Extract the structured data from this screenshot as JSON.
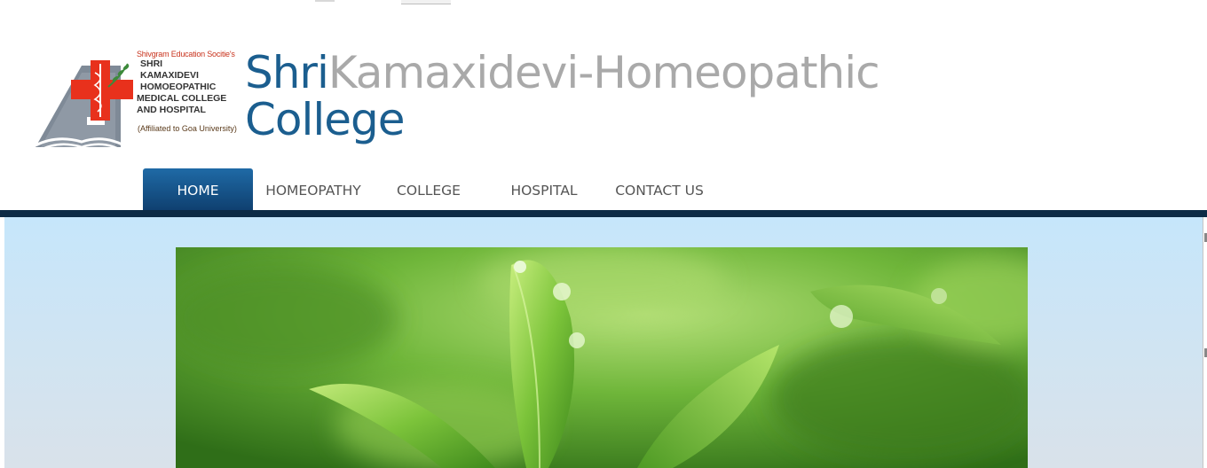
{
  "logo": {
    "society": "Shivgram Education Socitie's",
    "lines": [
      "SHRI",
      "KAMAXIDEVI",
      "HOMOEOPATHIC",
      "MEDICAL COLLEGE",
      "AND HOSPITAL"
    ],
    "affiliation": "(Affiliated to Goa University)",
    "cross_color": "#e8311c",
    "emblem_color": "#7f8a97"
  },
  "title": {
    "first": "Shri",
    "second": "Kamaxidevi-Homeopathic",
    "third": "College"
  },
  "nav": {
    "items": [
      {
        "label": "HOME",
        "active": true
      },
      {
        "label": "HOMEOPATHY",
        "active": false
      },
      {
        "label": "COLLEGE",
        "active": false
      },
      {
        "label": "HOSPITAL",
        "active": false
      },
      {
        "label": "CONTACT US",
        "active": false
      }
    ],
    "active_color": "#1a5c93",
    "bar_color": "#0d2b46"
  },
  "hero": {
    "subject": "green leaves with water droplets"
  }
}
